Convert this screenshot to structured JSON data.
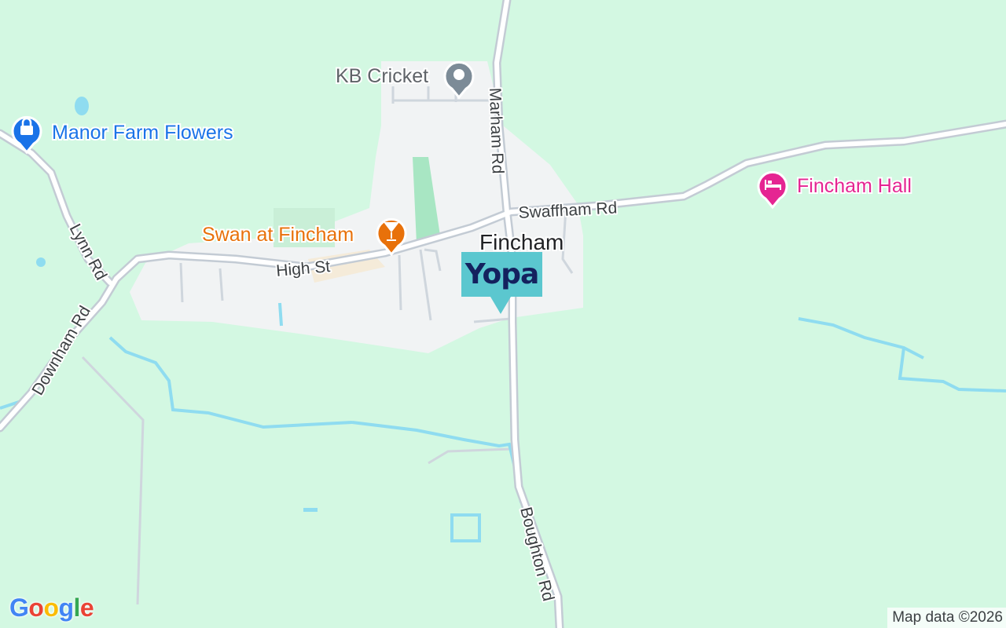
{
  "map": {
    "town": "Fincham",
    "roads": {
      "marham": "Marham Rd",
      "swaffham": "Swaffham Rd",
      "high_st": "High St",
      "lynn": "Lynn Rd",
      "downham": "Downham Rd",
      "boughton": "Boughton Rd"
    },
    "places": [
      {
        "name": "KB Cricket",
        "icon": "pin-icon",
        "color": "#7c8b97"
      },
      {
        "name": "Manor Farm Flowers",
        "icon": "shopping-bag-icon",
        "color": "#1a73e8"
      },
      {
        "name": "Swan at Fincham",
        "icon": "cocktail-icon",
        "color": "#e8710a"
      },
      {
        "name": "Fincham Hall",
        "icon": "bed-icon",
        "color": "#e52592"
      }
    ],
    "marker": {
      "logo": "Yopa",
      "color": "#5bc7cf"
    }
  },
  "branding": {
    "logo": "Google"
  },
  "attribution": "Map data ©2026",
  "colors": {
    "grass": "#d3f8e2",
    "built_up": "#f1f3f4",
    "park": "#a8e6c3",
    "water": "#8fdcf0",
    "road": "#ffffff",
    "road_casing": "#c3cbd4"
  }
}
